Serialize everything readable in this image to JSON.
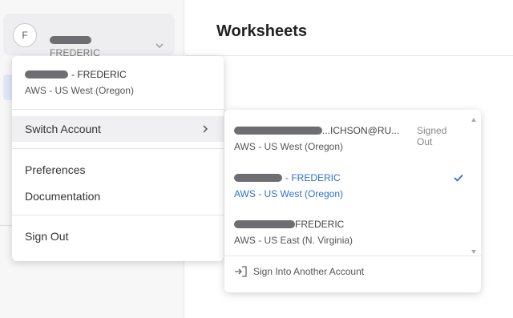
{
  "sidebar": {
    "avatar_letter": "F",
    "account_subtitle": "FREDERIC"
  },
  "main": {
    "title": "Worksheets"
  },
  "menu": {
    "current_account": {
      "name_suffix": "- FREDERIC",
      "region": "AWS - US West (Oregon)"
    },
    "switch_account_label": "Switch Account",
    "preferences_label": "Preferences",
    "documentation_label": "Documentation",
    "sign_out_label": "Sign Out"
  },
  "submenu": {
    "accounts": [
      {
        "name_visible": "...ICHSON@RU...",
        "status": "Signed Out",
        "region": "AWS - US West (Oregon)",
        "active": false
      },
      {
        "name_visible": "- FREDERIC",
        "status": "",
        "region": "AWS - US West (Oregon)",
        "active": true
      },
      {
        "name_visible": "FREDERIC",
        "status": "",
        "region": "AWS - US East (N. Virginia)",
        "active": false
      }
    ],
    "sign_into_another_label": "Sign Into Another Account"
  },
  "colors": {
    "accent": "#2f6fcf",
    "redaction": "#6e6e72"
  }
}
